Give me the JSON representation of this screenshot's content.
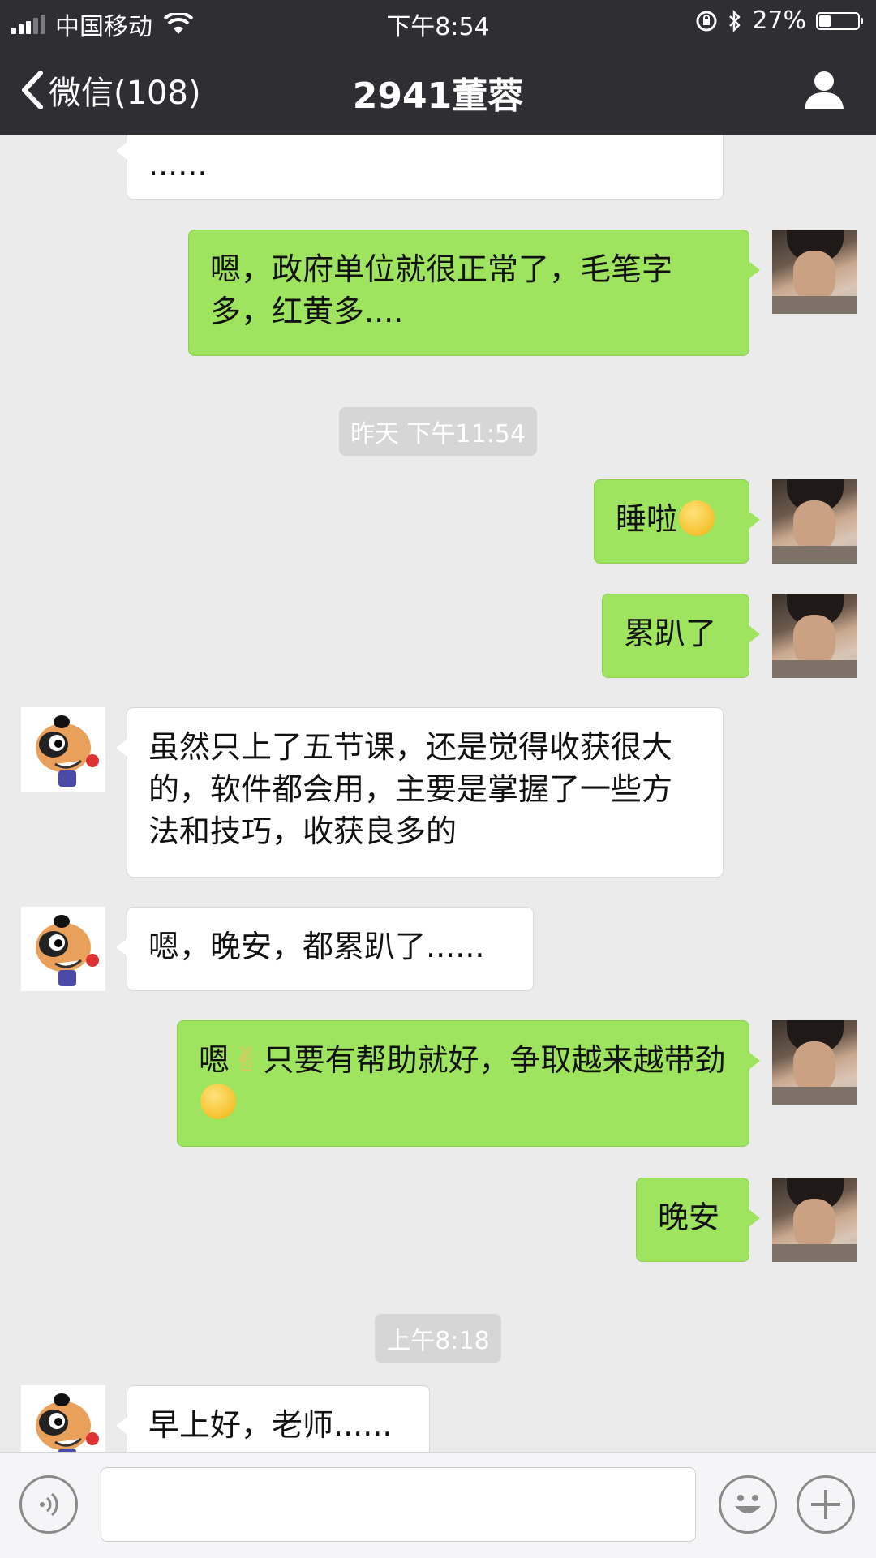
{
  "status_bar": {
    "carrier": "中国移动",
    "time": "下午8:54",
    "battery": "27%",
    "battery_level": 0.27
  },
  "nav": {
    "back_label": "微信(108)",
    "title": "2941董蓉",
    "profile_icon": "person-icon"
  },
  "messages": [
    {
      "side": "other",
      "text": "......"
    },
    {
      "side": "me",
      "text": "嗯，政府单位就很正常了，毛笔字多，红黄多...."
    },
    {
      "type": "time",
      "text": "昨天 下午11:54"
    },
    {
      "side": "me",
      "text": "睡啦",
      "emoji": "laughing-crying-emoji"
    },
    {
      "side": "me",
      "text": "累趴了"
    },
    {
      "side": "other",
      "text": "虽然只上了五节课，还是觉得收获很大的，软件都会用，主要是掌握了一些方法和技巧，收获良多的"
    },
    {
      "side": "other",
      "text": "嗯，晚安，都累趴了......"
    },
    {
      "side": "me",
      "text_a": "嗯",
      "text_b": "只要有帮助就好，争取越来越带劲",
      "emoji_a": "victory-hand-emoji",
      "emoji_b": "smirk-emoji"
    },
    {
      "side": "me",
      "text": "晚安"
    },
    {
      "type": "time",
      "text": "上午8:18"
    },
    {
      "side": "other",
      "text": "早上好，老师......"
    }
  ],
  "input_bar": {
    "voice_icon": "voice-icon",
    "emoji_icon": "emoji-icon",
    "plus_icon": "plus-icon",
    "value": ""
  }
}
